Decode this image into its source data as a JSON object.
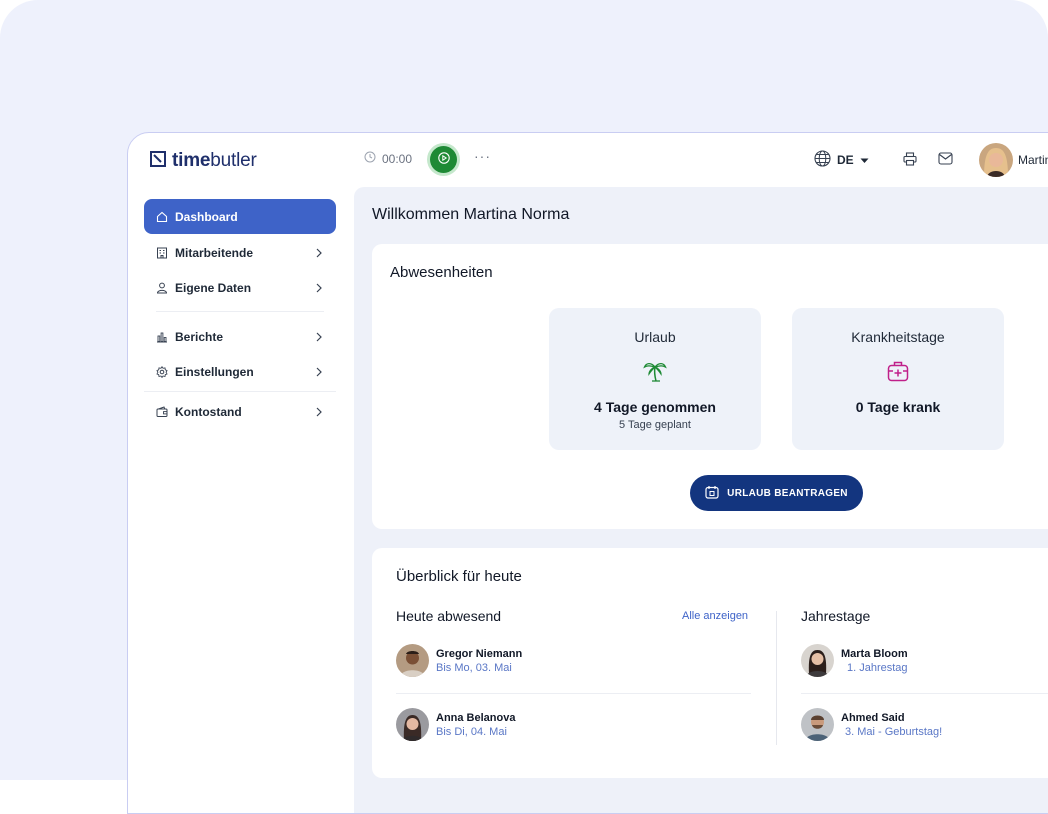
{
  "header": {
    "logo_part1": "time",
    "logo_part2": "butler",
    "timer": "00:00",
    "more": "···",
    "language": "DE",
    "user_name": "Martina Norma"
  },
  "sidebar": {
    "items": [
      {
        "label": "Dashboard",
        "icon": "home-icon",
        "active": true
      },
      {
        "label": "Mitarbeitende",
        "icon": "building-icon"
      },
      {
        "label": "Eigene Daten",
        "icon": "user-icon"
      },
      {
        "label": "Berichte",
        "icon": "bar-chart-icon"
      },
      {
        "label": "Einstellungen",
        "icon": "gear-icon"
      },
      {
        "label": "Kontostand",
        "icon": "wallet-icon"
      }
    ]
  },
  "main": {
    "welcome": "Willkommen Martina Norma",
    "absences": {
      "title": "Abwesenheiten",
      "vacation": {
        "label": "Urlaub",
        "value": "4 Tage genommen",
        "sub": "5 Tage geplant",
        "icon": "palm-tree-icon"
      },
      "sick": {
        "label": "Krankheitstage",
        "value": "0 Tage krank",
        "icon": "first-aid-kit-icon"
      },
      "request_button": "URLAUB BEANTRAGEN"
    },
    "overview": {
      "title": "Überblick für heute",
      "absent": {
        "title": "Heute abwesend",
        "link": "Alle anzeigen",
        "people": [
          {
            "name": "Gregor Niemann",
            "sub": "Bis Mo, 03. Mai"
          },
          {
            "name": "Anna Belanova",
            "sub": "Bis Di, 04. Mai"
          }
        ]
      },
      "anniversaries": {
        "title": "Jahrestage",
        "people": [
          {
            "name": "Marta Bloom",
            "sub": "1. Jahrestag"
          },
          {
            "name": "Ahmed Said",
            "sub": "3. Mai - Geburtstag!"
          }
        ]
      }
    }
  },
  "colors": {
    "accent": "#3e63c8",
    "button": "#13357f",
    "timer_green": "#1e8a35",
    "vacation_icon": "#1e8a35",
    "sick_icon": "#c0208a"
  }
}
